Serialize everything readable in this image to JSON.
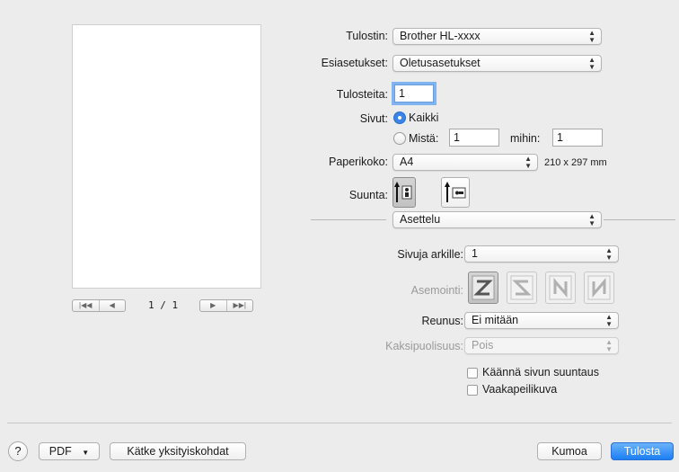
{
  "printer": {
    "label": "Tulostin:",
    "value": "Brother HL-xxxx"
  },
  "presets": {
    "label": "Esiasetukset:",
    "value": "Oletusasetukset"
  },
  "copies": {
    "label": "Tulosteita:",
    "value": "1"
  },
  "pages": {
    "label": "Sivut:",
    "all_label": "Kaikki",
    "from_label": "Mistä:",
    "from_value": "1",
    "to_label": "mihin:",
    "to_value": "1"
  },
  "paper_size": {
    "label": "Paperikoko:",
    "value": "A4",
    "dimensions": "210 x 297 mm"
  },
  "orientation": {
    "label": "Suunta:"
  },
  "section": {
    "value": "Asettelu"
  },
  "pages_per_sheet": {
    "label": "Sivuja arkille:",
    "value": "1"
  },
  "layout_direction": {
    "label": "Asemointi:",
    "icons": [
      "Z-icon",
      "S-icon",
      "N-mirror-icon",
      "N-icon"
    ]
  },
  "border": {
    "label": "Reunus:",
    "value": "Ei mitään"
  },
  "two_sided": {
    "label": "Kaksipuolisuus:",
    "value": "Pois"
  },
  "reverse_orientation": {
    "label": "Käännä sivun suuntaus"
  },
  "flip_horizontal": {
    "label": "Vaakapeilikuva"
  },
  "preview": {
    "page_counter": "1 / 1"
  },
  "footer": {
    "help": "?",
    "pdf": "PDF",
    "hide_details": "Kätke yksityiskohdat",
    "cancel": "Kumoa",
    "print": "Tulosta"
  },
  "colors": {
    "accent": "#1b7ef3",
    "focus_ring": "#7fb4f1"
  }
}
